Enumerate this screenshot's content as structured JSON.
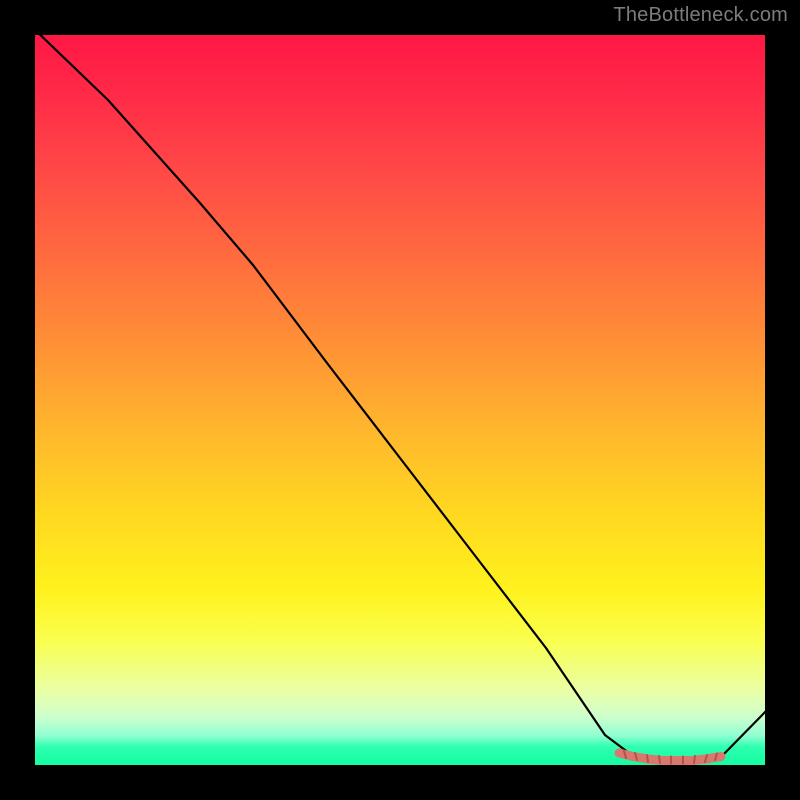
{
  "attribution": "TheBottleneck.com",
  "chart_data": {
    "type": "line",
    "title": "",
    "xlabel": "",
    "ylabel": "",
    "xlim": [
      0,
      100
    ],
    "ylim": [
      0,
      100
    ],
    "grid": false,
    "legend": false,
    "series": [
      {
        "name": "bottleneck-curve",
        "color": "#000000",
        "x": [
          0,
          10,
          23,
          30,
          40,
          50,
          60,
          70,
          78,
          82,
          86,
          90,
          94,
          100
        ],
        "y": [
          100,
          90,
          77,
          68,
          55,
          42,
          29,
          16,
          4,
          1,
          0.5,
          0.5,
          1,
          8
        ]
      },
      {
        "name": "optimal-zone-highlight",
        "color": "#d9786f",
        "x": [
          80,
          82,
          84,
          86,
          88,
          90,
          92,
          94
        ],
        "y": [
          1.5,
          1,
          0.7,
          0.5,
          0.5,
          0.5,
          0.7,
          1
        ]
      }
    ],
    "background_gradient": {
      "stops": [
        {
          "pos": 0,
          "color": "#ff1846"
        },
        {
          "pos": 0.5,
          "color": "#ffd920"
        },
        {
          "pos": 0.82,
          "color": "#f9ff4f"
        },
        {
          "pos": 0.97,
          "color": "#2fffb0"
        },
        {
          "pos": 1.0,
          "color": "#12fda0"
        }
      ]
    }
  }
}
